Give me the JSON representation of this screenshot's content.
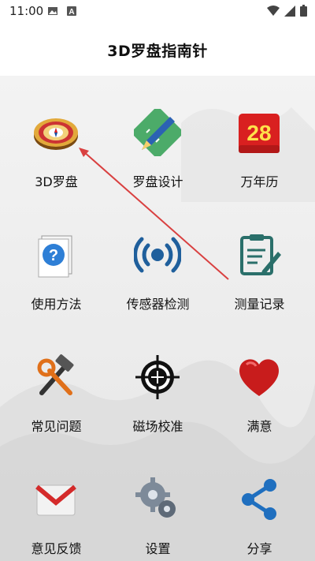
{
  "status_bar": {
    "time": "11:00"
  },
  "app": {
    "title": "3D罗盘指南针"
  },
  "grid": [
    {
      "label": "3D罗盘",
      "icon": "compass-3d-icon"
    },
    {
      "label": "罗盘设计",
      "icon": "design-tools-icon"
    },
    {
      "label": "万年历",
      "icon": "calendar-icon",
      "calendar_day": "28"
    },
    {
      "label": "使用方法",
      "icon": "help-document-icon"
    },
    {
      "label": "传感器检测",
      "icon": "sensor-signal-icon"
    },
    {
      "label": "测量记录",
      "icon": "notes-record-icon"
    },
    {
      "label": "常见问题",
      "icon": "tools-icon"
    },
    {
      "label": "磁场校准",
      "icon": "crosshair-icon"
    },
    {
      "label": "满意",
      "icon": "heart-icon"
    },
    {
      "label": "意见反馈",
      "icon": "mail-icon"
    },
    {
      "label": "设置",
      "icon": "gear-icon"
    },
    {
      "label": "分享",
      "icon": "share-icon"
    }
  ],
  "colors": {
    "accent_red": "#e02020",
    "arrow": "#d94040",
    "icon_blue": "#1f5f9c",
    "icon_teal": "#2a6f6a"
  }
}
